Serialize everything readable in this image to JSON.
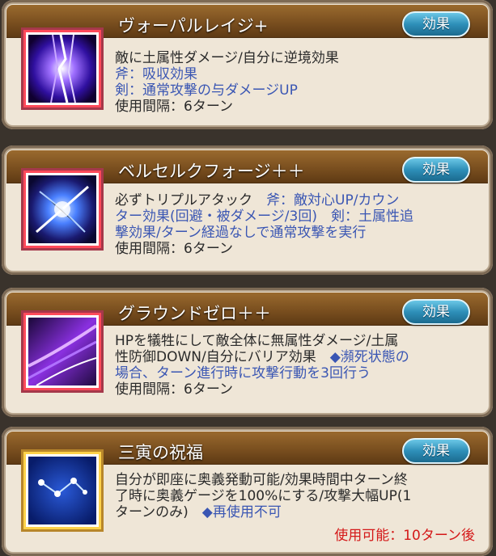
{
  "effect_button": "効果",
  "skills": [
    {
      "title": "ヴォーパルレイジ+",
      "lines": [
        [
          {
            "t": "敵に土属性ダメージ/自分に逆境効果",
            "c": "dark"
          }
        ],
        [
          {
            "t": "斧：吸収効果",
            "c": "blue"
          }
        ],
        [
          {
            "t": "剣：通常攻撃の与ダメージUP",
            "c": "blue"
          }
        ],
        [
          {
            "t": "使用間隔：6ターン",
            "c": "dark"
          }
        ]
      ],
      "icon": "purple-lightning-icon"
    },
    {
      "title": "ベルセルクフォージ＋＋",
      "lines": [
        [
          {
            "t": "必ずトリプルアタック　",
            "c": "dark"
          },
          {
            "t": "斧：敵対心UP/カウン",
            "c": "blue"
          }
        ],
        [
          {
            "t": "ター効果(回避・被ダメージ/3回)　剣：土属性追",
            "c": "blue"
          }
        ],
        [
          {
            "t": "撃効果/ターン経過なしで通常攻撃を実行",
            "c": "blue"
          }
        ],
        [
          {
            "t": "使用間隔：6ターン",
            "c": "dark"
          }
        ]
      ],
      "icon": "blue-burst-icon"
    },
    {
      "title": "グラウンドゼロ＋＋",
      "lines": [
        [
          {
            "t": "HPを犠牲にして敵全体に無属性ダメージ/土属",
            "c": "dark"
          }
        ],
        [
          {
            "t": "性防御DOWN/自分にバリア効果　",
            "c": "dark"
          },
          {
            "t": "◆瀕死状態の",
            "c": "blue"
          }
        ],
        [
          {
            "t": "場合、ターン進行時に攻撃行動を3回行う",
            "c": "blue"
          }
        ],
        [
          {
            "t": "使用間隔：6ターン",
            "c": "dark"
          }
        ]
      ],
      "icon": "purple-swirl-icon"
    },
    {
      "title": "三寅の祝福",
      "lines": [
        [
          {
            "t": "自分が即座に奥義発動可能/効果時間中ターン終",
            "c": "dark"
          }
        ],
        [
          {
            "t": "了時に奥義ゲージを100%にする/攻撃大幅UP(1",
            "c": "dark"
          }
        ],
        [
          {
            "t": "ターンのみ)　",
            "c": "dark"
          },
          {
            "t": "◆再使用不可",
            "c": "blue"
          }
        ]
      ],
      "cooldown": "使用可能：10ターン後",
      "icon": "constellation-icon"
    }
  ],
  "colors": {
    "header": "#7a4f1f",
    "blue_text": "#3a56b3",
    "red_text": "#d41818",
    "button": "#2e8fb8"
  }
}
